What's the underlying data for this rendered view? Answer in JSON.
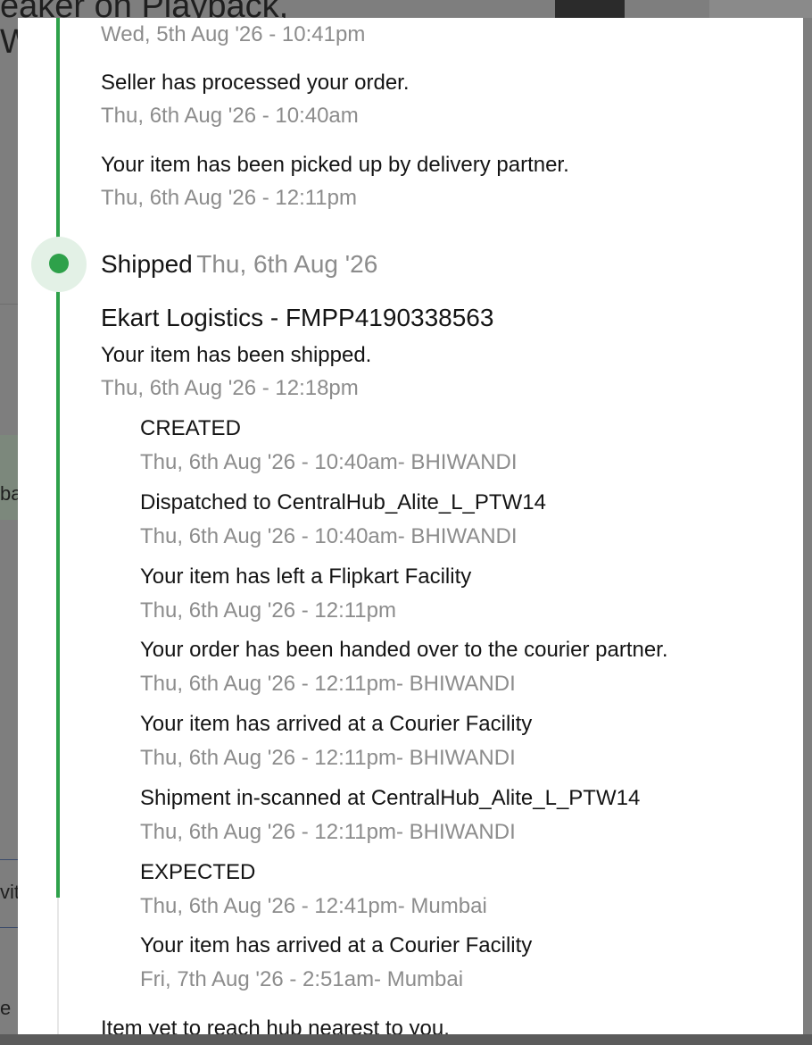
{
  "background": {
    "title_fragment": "eaker on Playback,",
    "w_fragment": "W",
    "fragment_1": "ba",
    "fragment_2": "vit",
    "fragment_3": "e"
  },
  "tracker": {
    "accent_color": "#2ea14a",
    "pre_events": [
      {
        "text": "",
        "time": "Wed, 5th Aug '26 - 10:41pm"
      },
      {
        "text": "Seller has processed your order.",
        "time": "Thu, 6th Aug '26 - 10:40am"
      },
      {
        "text": "Your item has been picked up by delivery partner.",
        "time": "Thu, 6th Aug '26 - 12:11pm"
      }
    ],
    "shipped": {
      "label": "Shipped",
      "date": "Thu, 6th Aug '26",
      "courier": "Ekart Logistics - FMPP4190338563",
      "message": "Your item has been shipped.",
      "time": "Thu, 6th Aug '26 - 12:18pm"
    },
    "scans": [
      {
        "text": "CREATED",
        "time": "Thu, 6th Aug '26 - 10:40am- BHIWANDI"
      },
      {
        "text": "Dispatched to CentralHub_Alite_L_PTW14",
        "time": "Thu, 6th Aug '26 - 10:40am- BHIWANDI"
      },
      {
        "text": "Your item has left a Flipkart Facility",
        "time": "Thu, 6th Aug '26 - 12:11pm"
      },
      {
        "text": "Your order has been handed over to the courier partner.",
        "time": "Thu, 6th Aug '26 - 12:11pm- BHIWANDI"
      },
      {
        "text": "Your item has arrived at a Courier Facility",
        "time": "Thu, 6th Aug '26 - 12:11pm- BHIWANDI"
      },
      {
        "text": "Shipment in-scanned at CentralHub_Alite_L_PTW14",
        "time": "Thu, 6th Aug '26 - 12:11pm- BHIWANDI"
      },
      {
        "text": "EXPECTED",
        "time": "Thu, 6th Aug '26 - 12:41pm- Mumbai"
      },
      {
        "text": "Your item has arrived at a Courier Facility",
        "time": "Fri, 7th Aug '26 - 2:51am- Mumbai"
      }
    ],
    "footer_note": "Item yet to reach hub nearest to you."
  }
}
